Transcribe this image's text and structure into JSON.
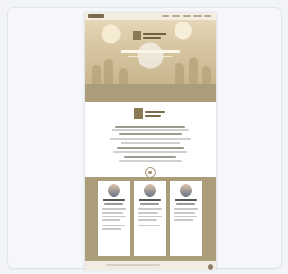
{
  "site": {
    "hero_tagline": "",
    "team": [
      {
        "name": "",
        "role": ""
      },
      {
        "name": "",
        "role": ""
      },
      {
        "name": "",
        "role": ""
      }
    ]
  },
  "colors": {
    "accent": "#ab9c7a",
    "hero": "#d8c7a2",
    "emblem": "#8c7a55",
    "background": "#f3f4f7"
  },
  "icons": [
    "logo-emblem-icon",
    "scroll-to-top-icon",
    "section-divider-icon"
  ]
}
